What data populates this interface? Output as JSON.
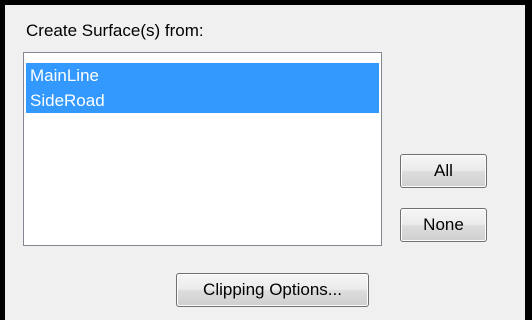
{
  "group": {
    "label": "Create Surface(s) from:"
  },
  "list": {
    "items": [
      {
        "label": "MainLine",
        "selected": true
      },
      {
        "label": "SideRoad",
        "selected": true
      }
    ],
    "selection_color": "#3399ff"
  },
  "buttons": {
    "all_label": "All",
    "none_label": "None",
    "clipping_label": "Clipping Options..."
  }
}
